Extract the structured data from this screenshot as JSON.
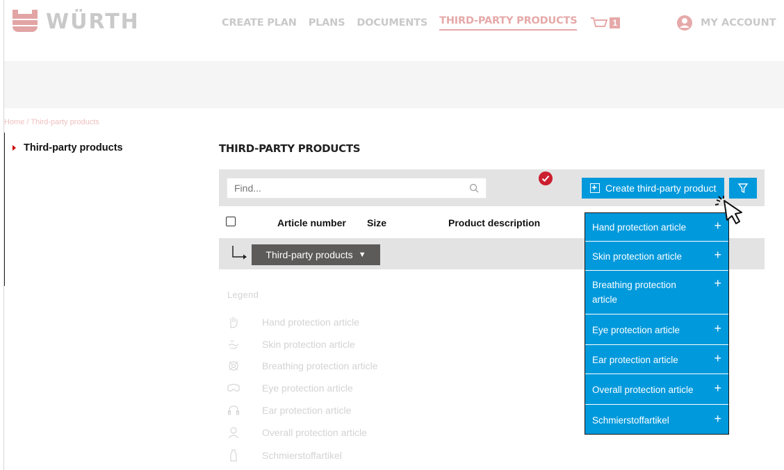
{
  "brand": {
    "logo_text": "WÜRTH"
  },
  "nav": {
    "items": [
      "CREATE PLAN",
      "PLANS",
      "DOCUMENTS",
      "THIRD-PARTY PRODUCTS"
    ],
    "active_index": 3,
    "cart_count": "1",
    "account_label": "MY ACCOUNT"
  },
  "breadcrumb": {
    "home": "Home",
    "separator": " / ",
    "current": "Third-party products"
  },
  "sidebar": {
    "items": [
      {
        "label": "Third-party products"
      }
    ]
  },
  "main": {
    "title": "THIRD-PARTY PRODUCTS",
    "search": {
      "placeholder": "Find...",
      "value": ""
    },
    "create_button": "Create third-party product",
    "filter_active": true,
    "table": {
      "columns": [
        "Article number",
        "Size",
        "Product description"
      ]
    },
    "group_dropdown": {
      "label": "Third-party products",
      "caret": "▼"
    }
  },
  "legend": {
    "title": "Legend",
    "items": [
      {
        "label": "Hand protection article",
        "icon": "hand-icon"
      },
      {
        "label": "Skin protection article",
        "icon": "skin-icon"
      },
      {
        "label": "Breathing protection article",
        "icon": "breathing-icon"
      },
      {
        "label": "Eye protection article",
        "icon": "goggles-icon"
      },
      {
        "label": "Ear protection article",
        "icon": "headphones-icon"
      },
      {
        "label": "Overall protection article",
        "icon": "person-icon"
      },
      {
        "label": "Schmierstoffartikel",
        "icon": "bottle-icon"
      }
    ]
  },
  "create_menu": {
    "items": [
      {
        "label": "Hand protection article"
      },
      {
        "label": "Skin protection article"
      },
      {
        "label": "Breathing protection article"
      },
      {
        "label": "Eye protection article"
      },
      {
        "label": "Ear protection article"
      },
      {
        "label": "Overall protection article"
      },
      {
        "label": "Schmierstoffartikel"
      }
    ],
    "add_symbol": "+"
  },
  "colors": {
    "accent_blue": "#0099dc",
    "brand_red": "#cc1f2f",
    "toolbar_gray": "#e3e3e3",
    "dropdown_dark": "#5d5a5a"
  }
}
